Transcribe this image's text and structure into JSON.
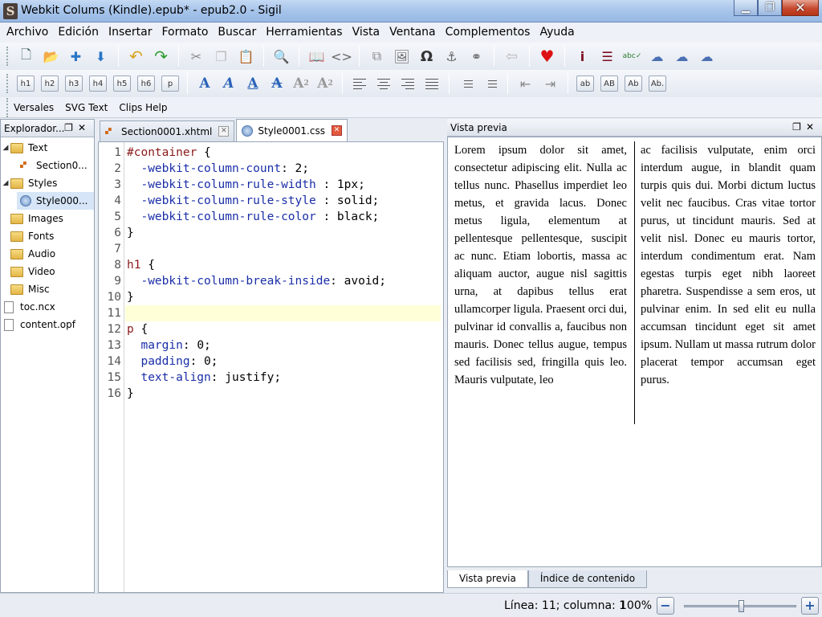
{
  "window": {
    "title": "Webkit Colums (Kindle).epub* - epub2.0 - Sigil",
    "app_icon": "S"
  },
  "menu": [
    "Archivo",
    "Edición",
    "Insertar",
    "Formato",
    "Buscar",
    "Herramientas",
    "Vista",
    "Ventana",
    "Complementos",
    "Ayuda"
  ],
  "toolbar3": [
    "Versales",
    "SVG Text",
    "Clips Help"
  ],
  "heading_buttons": [
    "h1",
    "h2",
    "h3",
    "h4",
    "h5",
    "h6",
    "p"
  ],
  "case_buttons": [
    "ab",
    "AB",
    "Ab",
    "Ab."
  ],
  "explorer": {
    "title": "Explorador...",
    "items": [
      {
        "label": "Text",
        "kind": "folder",
        "expanded": true
      },
      {
        "label": "Section0...",
        "kind": "html"
      },
      {
        "label": "Styles",
        "kind": "folder",
        "expanded": true
      },
      {
        "label": "Style000...",
        "kind": "css",
        "selected": true
      },
      {
        "label": "Images",
        "kind": "folder"
      },
      {
        "label": "Fonts",
        "kind": "folder"
      },
      {
        "label": "Audio",
        "kind": "folder"
      },
      {
        "label": "Video",
        "kind": "folder"
      },
      {
        "label": "Misc",
        "kind": "folder"
      },
      {
        "label": "toc.ncx",
        "kind": "file"
      },
      {
        "label": "content.opf",
        "kind": "file"
      }
    ]
  },
  "tabs": [
    {
      "label": "Section0001.xhtml",
      "active": false
    },
    {
      "label": "Style0001.css",
      "active": true
    }
  ],
  "code_lines": [
    "#container {",
    "  -webkit-column-count: 2;",
    "  -webkit-column-rule-width : 1px;",
    "  -webkit-column-rule-style : solid;",
    "  -webkit-column-rule-color : black;",
    "}",
    "",
    "h1 {",
    "  -webkit-column-break-inside: avoid;",
    "}",
    "",
    "p {",
    "  margin: 0;",
    "  padding: 0;",
    "  text-align: justify;",
    "}"
  ],
  "current_line": 11,
  "preview": {
    "title": "Vista previa",
    "col1": "Lorem ipsum dolor sit amet, consectetur adipiscing elit. Nulla ac tellus nunc. Phasellus imperdiet leo metus, et gravida lacus. Donec metus ligula, elementum at pellentesque pellentesque, suscipit ac nunc. Etiam lobortis, massa ac aliquam auctor, augue nisl sagittis urna, at dapibus tellus erat ullamcorper ligula. Praesent orci dui, pulvinar id convallis a, faucibus non mauris. Donec tellus augue, tempus sed facilisis sed, fringilla quis leo. Mauris vulputate, leo",
    "col2": "ac facilisis vulputate, enim orci interdum augue, in blandit quam turpis quis dui. Morbi dictum luctus velit nec faucibus. Cras vitae tortor purus, ut tincidunt mauris. Sed at velit nisl. Donec eu mauris tortor, interdum condimentum erat. Nam egestas turpis eget nibh laoreet pharetra. Suspendisse a sem eros, ut pulvinar enim. In sed elit eu nulla accumsan tincidunt eget sit amet ipsum. Nullam ut massa rutrum dolor placerat tempor accumsan eget purus.",
    "tabs": [
      "Vista previa",
      "Índice de contenido"
    ]
  },
  "status": {
    "position": "Línea: 11; columna: 1",
    "zoom": "100%",
    "zoom_out": "−",
    "zoom_in": "+",
    "zoom_level": 0.5
  }
}
